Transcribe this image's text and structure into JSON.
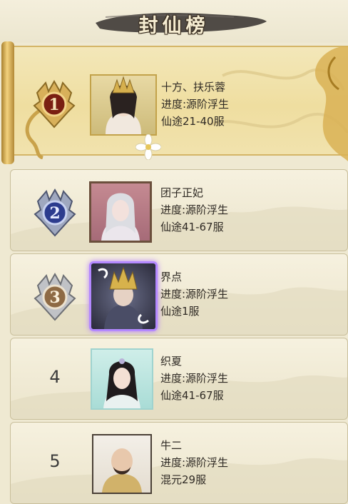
{
  "header": {
    "title": "封仙榜"
  },
  "colors": {
    "gold": "#d8b05a",
    "silver": "#9fa3aa",
    "bronze": "#8e6a44",
    "rank_one": "#7a1f12",
    "rank_two": "#2c3c8e"
  },
  "entries": [
    {
      "rank": "1",
      "name": "十方、扶乐蓉",
      "progress": "进度:源阶浮生",
      "server": "仙途21-40服",
      "medal": "gold"
    },
    {
      "rank": "2",
      "name": "团子正妃",
      "progress": "进度:源阶浮生",
      "server": "仙途41-67服",
      "medal": "blue"
    },
    {
      "rank": "3",
      "name": "界点",
      "progress": "进度:源阶浮生",
      "server": "仙途1服",
      "medal": "silver"
    },
    {
      "rank": "4",
      "name": "织夏",
      "progress": "进度:源阶浮生",
      "server": "仙途41-67服"
    },
    {
      "rank": "5",
      "name": "牛二",
      "progress": "进度:源阶浮生",
      "server": "混元29服"
    }
  ]
}
